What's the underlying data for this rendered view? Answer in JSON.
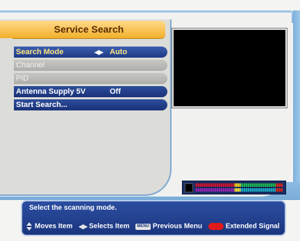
{
  "title": "Service Search",
  "menu": [
    {
      "label": "Search Mode",
      "value": "Auto",
      "state": "active"
    },
    {
      "label": "Channel",
      "value": "",
      "state": "disabled"
    },
    {
      "label": "PID",
      "value": "",
      "state": "disabled"
    },
    {
      "label": "Antenna Supply 5V",
      "value": "Off",
      "state": "normal"
    },
    {
      "label": "Start Search...",
      "value": "",
      "state": "normal"
    }
  ],
  "help": {
    "text": "Select the scanning mode.",
    "legend": {
      "moves": "Moves Item",
      "selects": "Selects Item",
      "menu_key": "MENU",
      "previous": "Previous Menu",
      "extended": "Extended Signal"
    }
  },
  "icons": {
    "updown": "up-down-arrows-icon",
    "leftright": "left-right-arrows-icon",
    "menu": "menu-key-icon",
    "red": "red-key-icon"
  },
  "colors": {
    "title_bg": "#f2b02a",
    "menu_active": "#1f3a86",
    "menu_disabled": "#adadaa",
    "help_bg": "#1a357f",
    "red_key": "#e01a1a"
  }
}
